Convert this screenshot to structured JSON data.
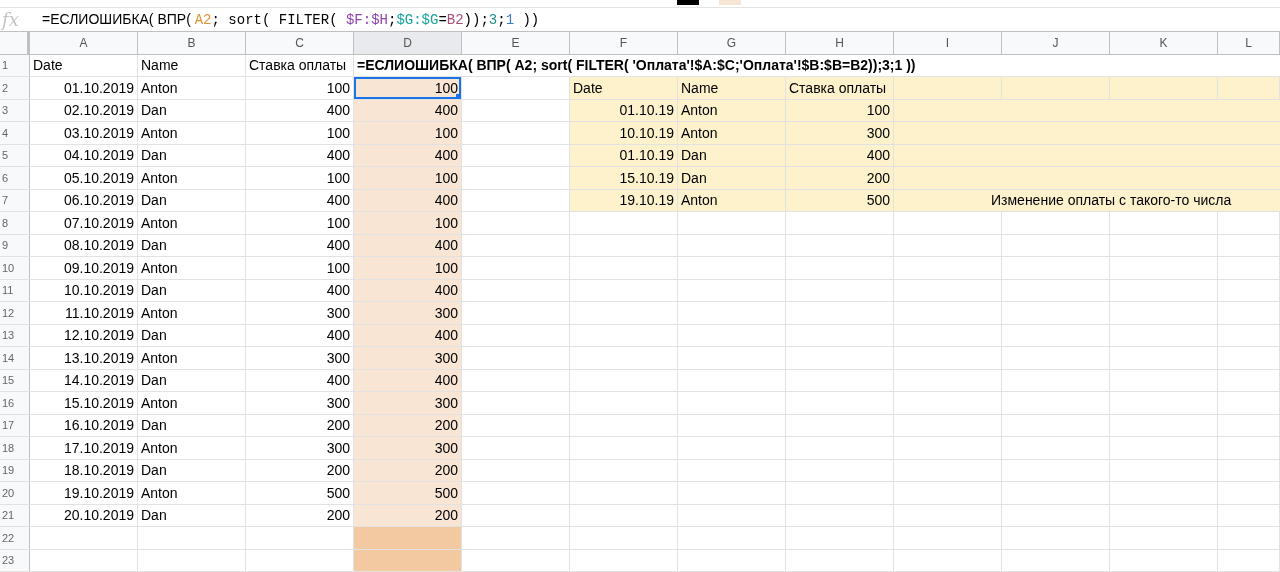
{
  "formula_bar": {
    "label": "fx",
    "segments": [
      {
        "text": "=ЕСЛИОШИБКА( ВПР( ",
        "kind": "plain"
      },
      {
        "text": "A2",
        "kind": "ref",
        "color": "#e69138"
      },
      {
        "text": "; sort( FILTER( ",
        "kind": "code"
      },
      {
        "text": "$F:$H",
        "kind": "ref",
        "color": "#8e44ad"
      },
      {
        "text": ";",
        "kind": "code"
      },
      {
        "text": "$G:$G",
        "kind": "ref",
        "color": "#16a39a"
      },
      {
        "text": "=",
        "kind": "code"
      },
      {
        "text": "B2",
        "kind": "ref",
        "color": "#a64d79"
      },
      {
        "text": "));",
        "kind": "code"
      },
      {
        "text": "3",
        "kind": "ref",
        "color": "#1c8a8a"
      },
      {
        "text": ";",
        "kind": "code"
      },
      {
        "text": "1",
        "kind": "ref",
        "color": "#3c78d8"
      },
      {
        "text": " ))",
        "kind": "code"
      }
    ]
  },
  "columns": [
    {
      "label": "A",
      "selected": false
    },
    {
      "label": "B",
      "selected": false
    },
    {
      "label": "C",
      "selected": false
    },
    {
      "label": "D",
      "selected": true
    },
    {
      "label": "E",
      "selected": false
    },
    {
      "label": "F",
      "selected": false
    },
    {
      "label": "G",
      "selected": false
    },
    {
      "label": "H",
      "selected": false
    },
    {
      "label": "I",
      "selected": false
    },
    {
      "label": "J",
      "selected": false
    },
    {
      "label": "K",
      "selected": false
    },
    {
      "label": "L",
      "selected": false
    }
  ],
  "rows": [
    {
      "label": "1",
      "kind": "header",
      "cells": [
        "Date",
        "Name",
        "Ставка оплаты"
      ],
      "d": {
        "text": "=ЕСЛИОШИБКА( ВПР( A2; sort( FILTER( 'Оплата'!$A:$C;'Оплата'!$B:$B=B2));3;1 ))"
      }
    },
    {
      "label": "2",
      "kind": "data",
      "cells": [
        "01.10.2019",
        "Anton",
        "100"
      ],
      "d": {
        "text": "100",
        "color": "#f9e5d3",
        "selected": true
      },
      "lookup": {
        "kind": "header",
        "cells": [
          "Date",
          "Name",
          "Ставка оплаты"
        ]
      }
    },
    {
      "label": "3",
      "kind": "data",
      "cells": [
        "02.10.2019",
        "Dan",
        "400"
      ],
      "d": {
        "text": "400",
        "color": "#f9e5d3",
        "selected": false
      },
      "lookup": {
        "kind": "data",
        "cells": [
          "01.10.19",
          "Anton",
          "100"
        ]
      }
    },
    {
      "label": "4",
      "kind": "data",
      "cells": [
        "03.10.2019",
        "Anton",
        "100"
      ],
      "d": {
        "text": "100",
        "color": "#f9e5d3",
        "selected": false
      },
      "lookup": {
        "kind": "data",
        "cells": [
          "10.10.19",
          "Anton",
          "300"
        ]
      }
    },
    {
      "label": "5",
      "kind": "data",
      "cells": [
        "04.10.2019",
        "Dan",
        "400"
      ],
      "d": {
        "text": "400",
        "color": "#f9e5d3",
        "selected": false
      },
      "lookup": {
        "kind": "data",
        "cells": [
          "01.10.19",
          "Dan",
          "400"
        ]
      }
    },
    {
      "label": "6",
      "kind": "data",
      "cells": [
        "05.10.2019",
        "Anton",
        "100"
      ],
      "d": {
        "text": "100",
        "color": "#f9e5d3",
        "selected": false
      },
      "lookup": {
        "kind": "data",
        "cells": [
          "15.10.19",
          "Dan",
          "200"
        ]
      }
    },
    {
      "label": "7",
      "kind": "data",
      "cells": [
        "06.10.2019",
        "Dan",
        "400"
      ],
      "d": {
        "text": "400",
        "color": "#f9e5d3",
        "selected": false
      },
      "lookup": {
        "kind": "data",
        "cells": [
          "19.10.19",
          "Anton",
          "500"
        ],
        "note": "Изменение оплаты с такого-то числа"
      }
    },
    {
      "label": "8",
      "kind": "data",
      "cells": [
        "07.10.2019",
        "Anton",
        "100"
      ],
      "d": {
        "text": "100",
        "color": "#f9e5d3",
        "selected": false
      }
    },
    {
      "label": "9",
      "kind": "data",
      "cells": [
        "08.10.2019",
        "Dan",
        "400"
      ],
      "d": {
        "text": "400",
        "color": "#f9e5d3",
        "selected": false
      }
    },
    {
      "label": "10",
      "kind": "data",
      "cells": [
        "09.10.2019",
        "Anton",
        "100"
      ],
      "d": {
        "text": "100",
        "color": "#f9e5d3",
        "selected": false
      }
    },
    {
      "label": "11",
      "kind": "data",
      "cells": [
        "10.10.2019",
        "Dan",
        "400"
      ],
      "d": {
        "text": "400",
        "color": "#f9e5d3",
        "selected": false
      }
    },
    {
      "label": "12",
      "kind": "data",
      "cells": [
        "11.10.2019",
        "Anton",
        "300"
      ],
      "d": {
        "text": "300",
        "color": "#f9e5d3",
        "selected": false
      }
    },
    {
      "label": "13",
      "kind": "data",
      "cells": [
        "12.10.2019",
        "Dan",
        "400"
      ],
      "d": {
        "text": "400",
        "color": "#f9e5d3",
        "selected": false
      }
    },
    {
      "label": "14",
      "kind": "data",
      "cells": [
        "13.10.2019",
        "Anton",
        "300"
      ],
      "d": {
        "text": "300",
        "color": "#f9e5d3",
        "selected": false
      }
    },
    {
      "label": "15",
      "kind": "data",
      "cells": [
        "14.10.2019",
        "Dan",
        "400"
      ],
      "d": {
        "text": "400",
        "color": "#f9e5d3",
        "selected": false
      }
    },
    {
      "label": "16",
      "kind": "data",
      "cells": [
        "15.10.2019",
        "Anton",
        "300"
      ],
      "d": {
        "text": "300",
        "color": "#f9e5d3",
        "selected": false
      }
    },
    {
      "label": "17",
      "kind": "data",
      "cells": [
        "16.10.2019",
        "Dan",
        "200"
      ],
      "d": {
        "text": "200",
        "color": "#f9e5d3",
        "selected": false
      }
    },
    {
      "label": "18",
      "kind": "data",
      "cells": [
        "17.10.2019",
        "Anton",
        "300"
      ],
      "d": {
        "text": "300",
        "color": "#f9e5d3",
        "selected": false
      }
    },
    {
      "label": "19",
      "kind": "data",
      "cells": [
        "18.10.2019",
        "Dan",
        "200"
      ],
      "d": {
        "text": "200",
        "color": "#f9e5d3",
        "selected": false
      }
    },
    {
      "label": "20",
      "kind": "data",
      "cells": [
        "19.10.2019",
        "Anton",
        "500"
      ],
      "d": {
        "text": "500",
        "color": "#f9e5d3",
        "selected": false
      }
    },
    {
      "label": "21",
      "kind": "data",
      "cells": [
        "20.10.2019",
        "Dan",
        "200"
      ],
      "d": {
        "text": "200",
        "color": "#f9e5d3",
        "selected": false
      }
    },
    {
      "label": "22",
      "kind": "empty",
      "d": {
        "color": "#f2c9a0",
        "selected": false
      }
    },
    {
      "label": "23",
      "kind": "empty",
      "d": {
        "color": "#f2c9a0",
        "selected": false
      }
    }
  ]
}
